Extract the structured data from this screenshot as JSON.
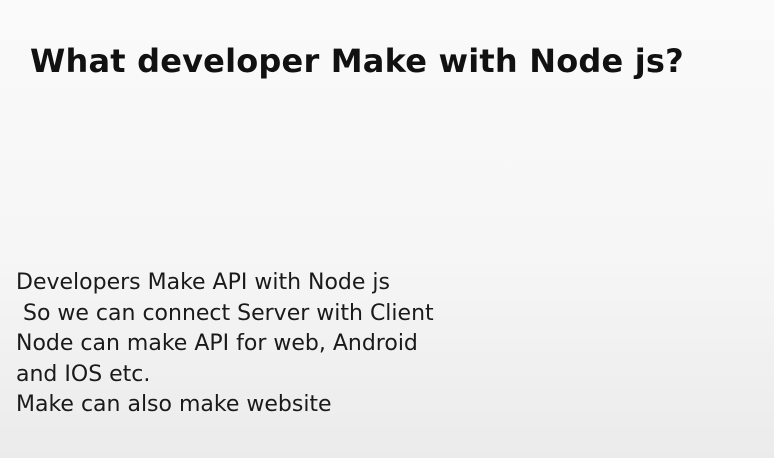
{
  "slide": {
    "title": "What developer Make with Node js?",
    "lines": [
      "Developers Make API with Node js",
      " So we can connect Server with Client",
      "Node can make API for web, Android",
      "and IOS etc.",
      "Make can also make website"
    ]
  },
  "colors": {
    "background": "#f7f7f7",
    "title_text": "#111111",
    "body_text": "#1a1a1a"
  }
}
